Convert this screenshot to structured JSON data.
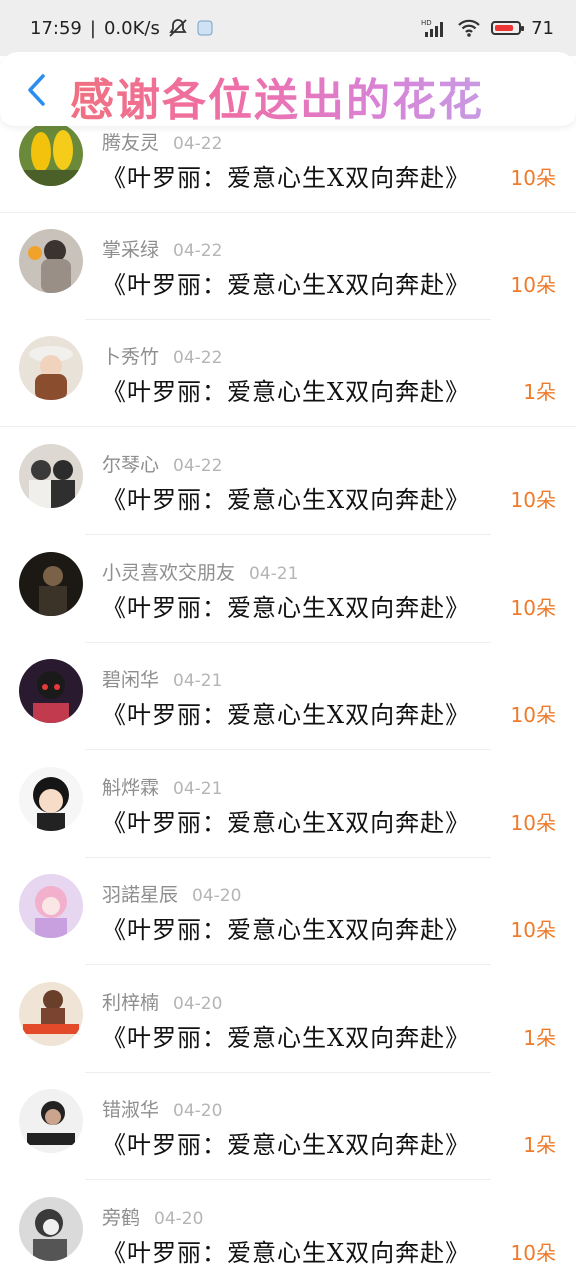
{
  "status_bar": {
    "time": "17:59",
    "speed": "0.0K/s",
    "battery": "71"
  },
  "header": {
    "title": "感谢各位送出的花花"
  },
  "colors": {
    "count": "#ef7a2a",
    "title_gradient": [
      "#f07080",
      "#d982d6"
    ]
  },
  "rows": [
    {
      "name": "腾友灵",
      "date": "04-22",
      "gift": "《叶罗丽：爱意心生X双向奔赴》",
      "count": "10朵",
      "avatar": "yellow-flowers"
    },
    {
      "name": "掌采绿",
      "date": "04-22",
      "gift": "《叶罗丽：爱意心生X双向奔赴》",
      "count": "10朵",
      "avatar": "girl-flowers"
    },
    {
      "name": "卜秀竹",
      "date": "04-22",
      "gift": "《叶罗丽：爱意心生X双向奔赴》",
      "count": "1朵",
      "avatar": "girl-hat"
    },
    {
      "name": "尔琴心",
      "date": "04-22",
      "gift": "《叶罗丽：爱意心生X双向奔赴》",
      "count": "10朵",
      "avatar": "couple"
    },
    {
      "name": "小灵喜欢交朋友",
      "date": "04-21",
      "gift": "《叶罗丽：爱意心生X双向奔赴》",
      "count": "10朵",
      "avatar": "dark-portrait"
    },
    {
      "name": "碧闲华",
      "date": "04-21",
      "gift": "《叶罗丽：爱意心生X双向奔赴》",
      "count": "10朵",
      "avatar": "anime-red"
    },
    {
      "name": "斛烨霖",
      "date": "04-21",
      "gift": "《叶罗丽：爱意心生X双向奔赴》",
      "count": "10朵",
      "avatar": "chibi-boy"
    },
    {
      "name": "羽諾星辰",
      "date": "04-20",
      "gift": "《叶罗丽：爱意心生X双向奔赴》",
      "count": "10朵",
      "avatar": "anime-pink"
    },
    {
      "name": "利梓楠",
      "date": "04-20",
      "gift": "《叶罗丽：爱意心生X双向奔赴》",
      "count": "1朵",
      "avatar": "girl-sign"
    },
    {
      "name": "错淑华",
      "date": "04-20",
      "gift": "《叶罗丽：爱意心生X双向奔赴》",
      "count": "1朵",
      "avatar": "boy-bw"
    },
    {
      "name": "旁鹤",
      "date": "04-20",
      "gift": "《叶罗丽：爱意心生X双向奔赴》",
      "count": "10朵",
      "avatar": "girl-bw"
    }
  ]
}
